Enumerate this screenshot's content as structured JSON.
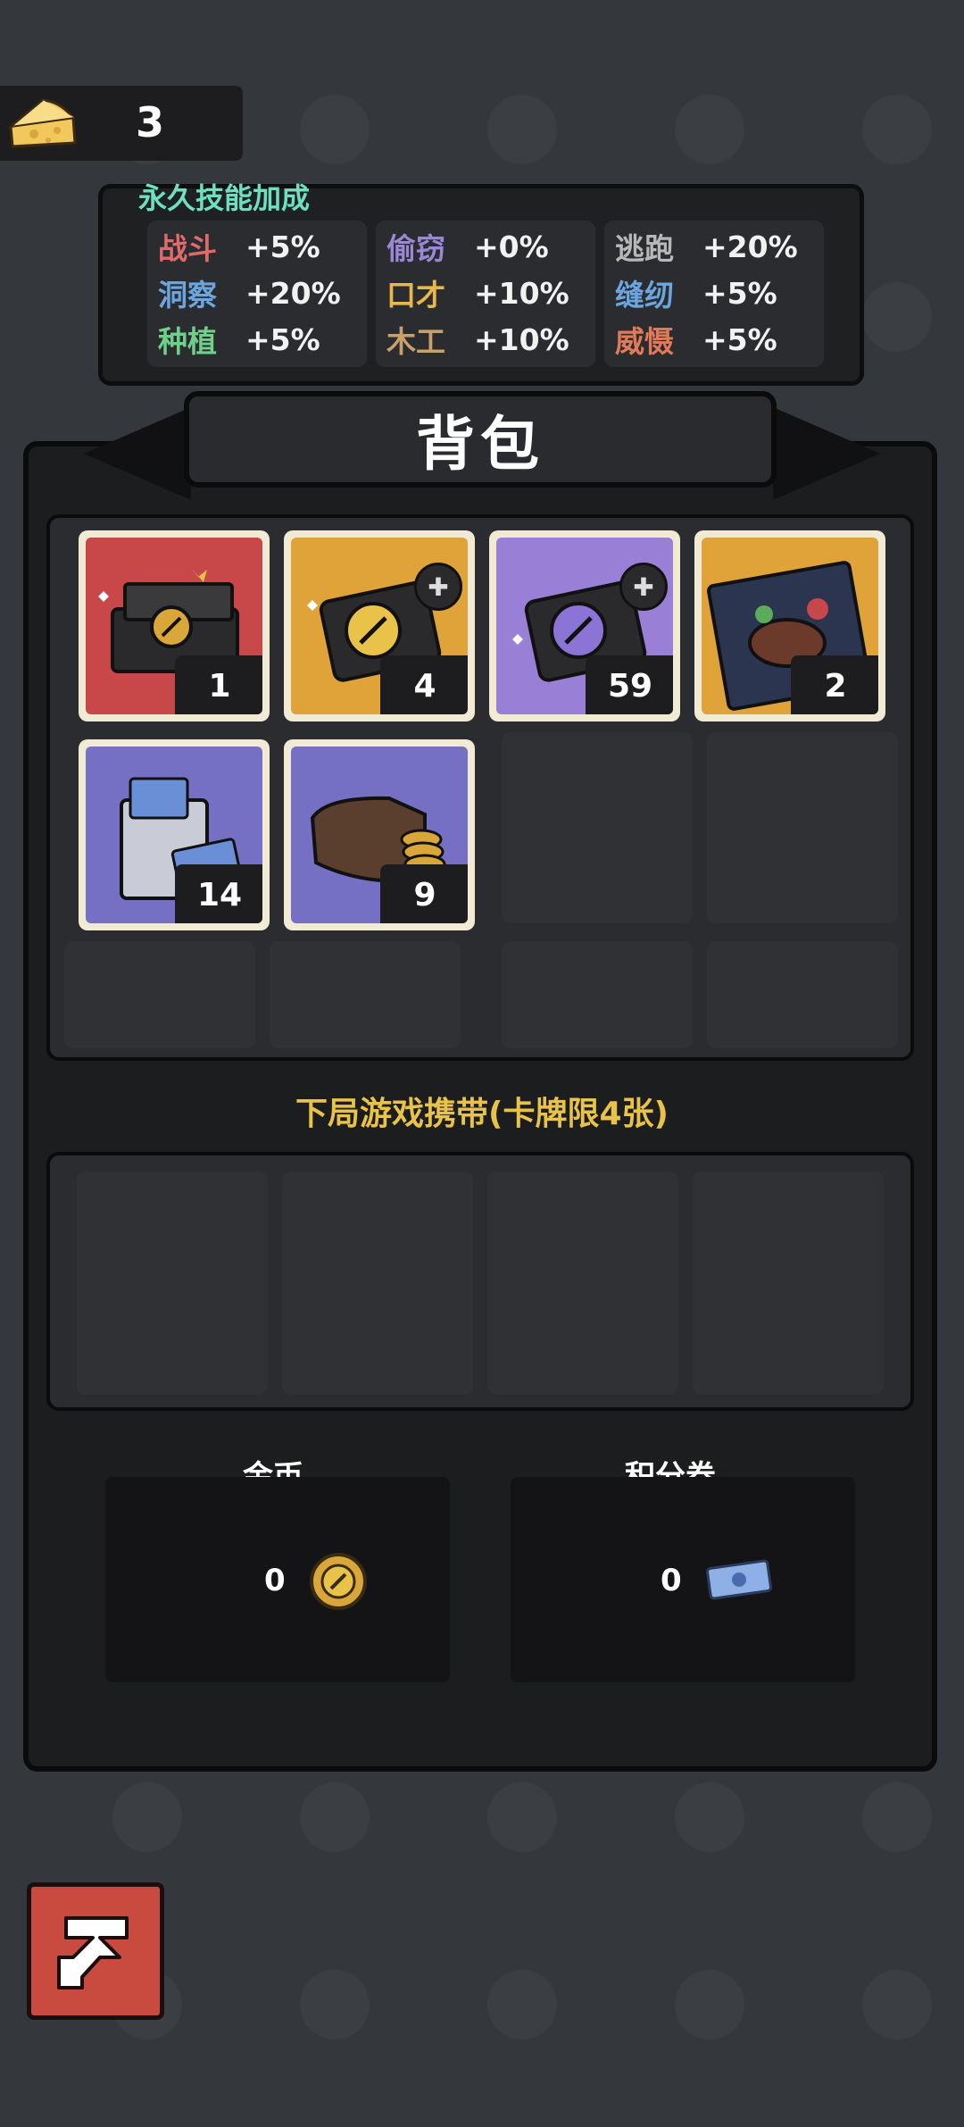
{
  "resources": {
    "cheese_count": "3"
  },
  "skills": {
    "title": "永久技能加成",
    "columns": [
      [
        {
          "name": "战斗",
          "value": "+5%",
          "color": "#e06b6b"
        },
        {
          "name": "洞察",
          "value": "+20%",
          "color": "#6ba6e0"
        },
        {
          "name": "种植",
          "value": "+5%",
          "color": "#6fd08a"
        }
      ],
      [
        {
          "name": "偷窃",
          "value": "+0%",
          "color": "#9a88d6"
        },
        {
          "name": "口才",
          "value": "+10%",
          "color": "#e9b84a"
        },
        {
          "name": "木工",
          "value": "+10%",
          "color": "#c9a06a"
        }
      ],
      [
        {
          "name": "逃跑",
          "value": "+20%",
          "color": "#b8b8b8"
        },
        {
          "name": "缝纫",
          "value": "+5%",
          "color": "#6ba6e0"
        },
        {
          "name": "威慑",
          "value": "+5%",
          "color": "#e07a5a"
        }
      ]
    ]
  },
  "backpack": {
    "title": "背包",
    "items": [
      {
        "name": "gift-box-red",
        "qty": "1"
      },
      {
        "name": "coin-box-gold",
        "qty": "4"
      },
      {
        "name": "coin-box-purple",
        "qty": "59"
      },
      {
        "name": "steak-packet",
        "qty": "2"
      },
      {
        "name": "ticket-bag",
        "qty": "14"
      },
      {
        "name": "wallet",
        "qty": "9"
      }
    ]
  },
  "carry": {
    "label": "下局游戏携带(卡牌限4张)"
  },
  "currency": {
    "gold": {
      "label": "金币",
      "value": "0"
    },
    "points": {
      "label": "积分券",
      "value": "0"
    }
  },
  "colors": {
    "accent_teal": "#6ee0c0",
    "accent_yellow": "#e9c24a",
    "back_red": "#c94a3e"
  }
}
